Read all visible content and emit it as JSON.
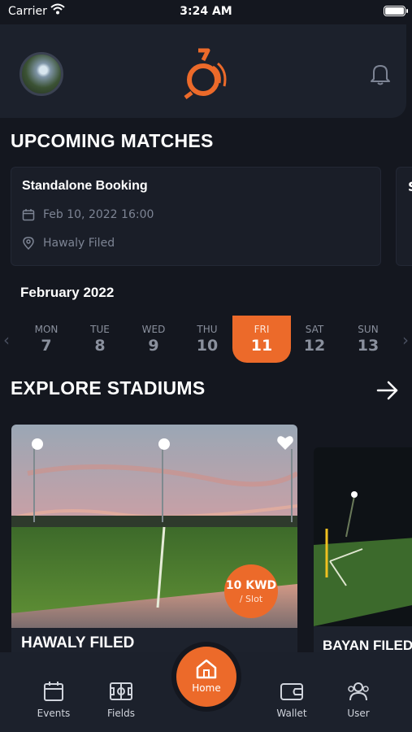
{
  "status_bar": {
    "carrier": "Carrier",
    "time": "3:24 AM"
  },
  "header": {
    "avatar": "user-avatar",
    "logo": "whistle-logo",
    "notification_icon": "bell-icon"
  },
  "upcoming": {
    "title": "UPCOMING MATCHES",
    "matches": [
      {
        "name": "Standalone Booking",
        "date": "Feb 10, 2022 16:00",
        "location": "Hawaly Filed"
      },
      {
        "name": "S"
      }
    ]
  },
  "calendar": {
    "month": "February 2022",
    "days": [
      {
        "name": "MON",
        "num": "7"
      },
      {
        "name": "TUE",
        "num": "8"
      },
      {
        "name": "WED",
        "num": "9"
      },
      {
        "name": "THU",
        "num": "10"
      },
      {
        "name": "FRI",
        "num": "11"
      },
      {
        "name": "SAT",
        "num": "12"
      },
      {
        "name": "SUN",
        "num": "13"
      }
    ],
    "selected_index": 4
  },
  "explore": {
    "title": "EXPLORE STADIUMS",
    "stadiums": [
      {
        "name": "HAWALY FILED",
        "price": "10 KWD",
        "price_unit": "/ Slot"
      },
      {
        "name": "BAYAN FILED"
      }
    ]
  },
  "bottom_nav": {
    "items": [
      {
        "label": "Events",
        "icon": "calendar-icon"
      },
      {
        "label": "Fields",
        "icon": "field-icon"
      },
      {
        "label": "Home",
        "icon": "home-icon"
      },
      {
        "label": "Wallet",
        "icon": "wallet-icon"
      },
      {
        "label": "User",
        "icon": "users-icon"
      }
    ]
  },
  "colors": {
    "accent": "#ec6a2a",
    "background": "#14171f",
    "card": "#1a1e28"
  }
}
